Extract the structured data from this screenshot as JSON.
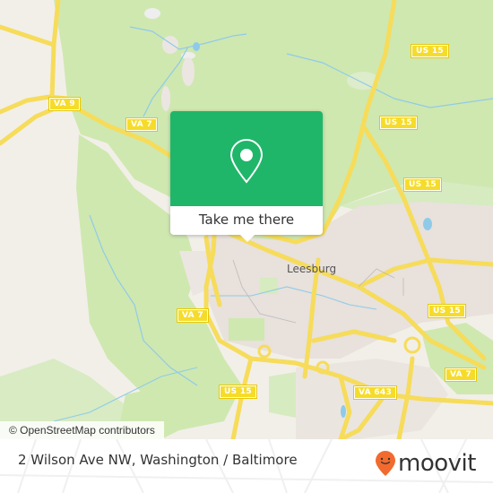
{
  "map": {
    "city_label": "Leesburg",
    "attribution": "© OpenStreetMap contributors",
    "route_shields": [
      {
        "id": "va9",
        "label": "VA 9"
      },
      {
        "id": "va7-nw",
        "label": "VA 7"
      },
      {
        "id": "us15-n1",
        "label": "US 15"
      },
      {
        "id": "us15-n2",
        "label": "US 15"
      },
      {
        "id": "us15-n3",
        "label": "US 15"
      },
      {
        "id": "us15-e",
        "label": "US 15"
      },
      {
        "id": "va7-w",
        "label": "VA 7"
      },
      {
        "id": "va7-se",
        "label": "VA 7"
      },
      {
        "id": "va643",
        "label": "VA 643"
      },
      {
        "id": "us15-s",
        "label": "US 15"
      }
    ],
    "colors": {
      "forest": "#cfe8b0",
      "urban": "#e9e3df",
      "highway": "#f6dc5a",
      "water": "#8fcbe8"
    }
  },
  "popup": {
    "button_label": "Take me there",
    "icon": "location-pin-icon",
    "color": "#1fb66a"
  },
  "footer": {
    "address": "2 Wilson Ave NW, Washington / Baltimore",
    "brand": "moovit",
    "brand_color": "#f26a2e"
  }
}
